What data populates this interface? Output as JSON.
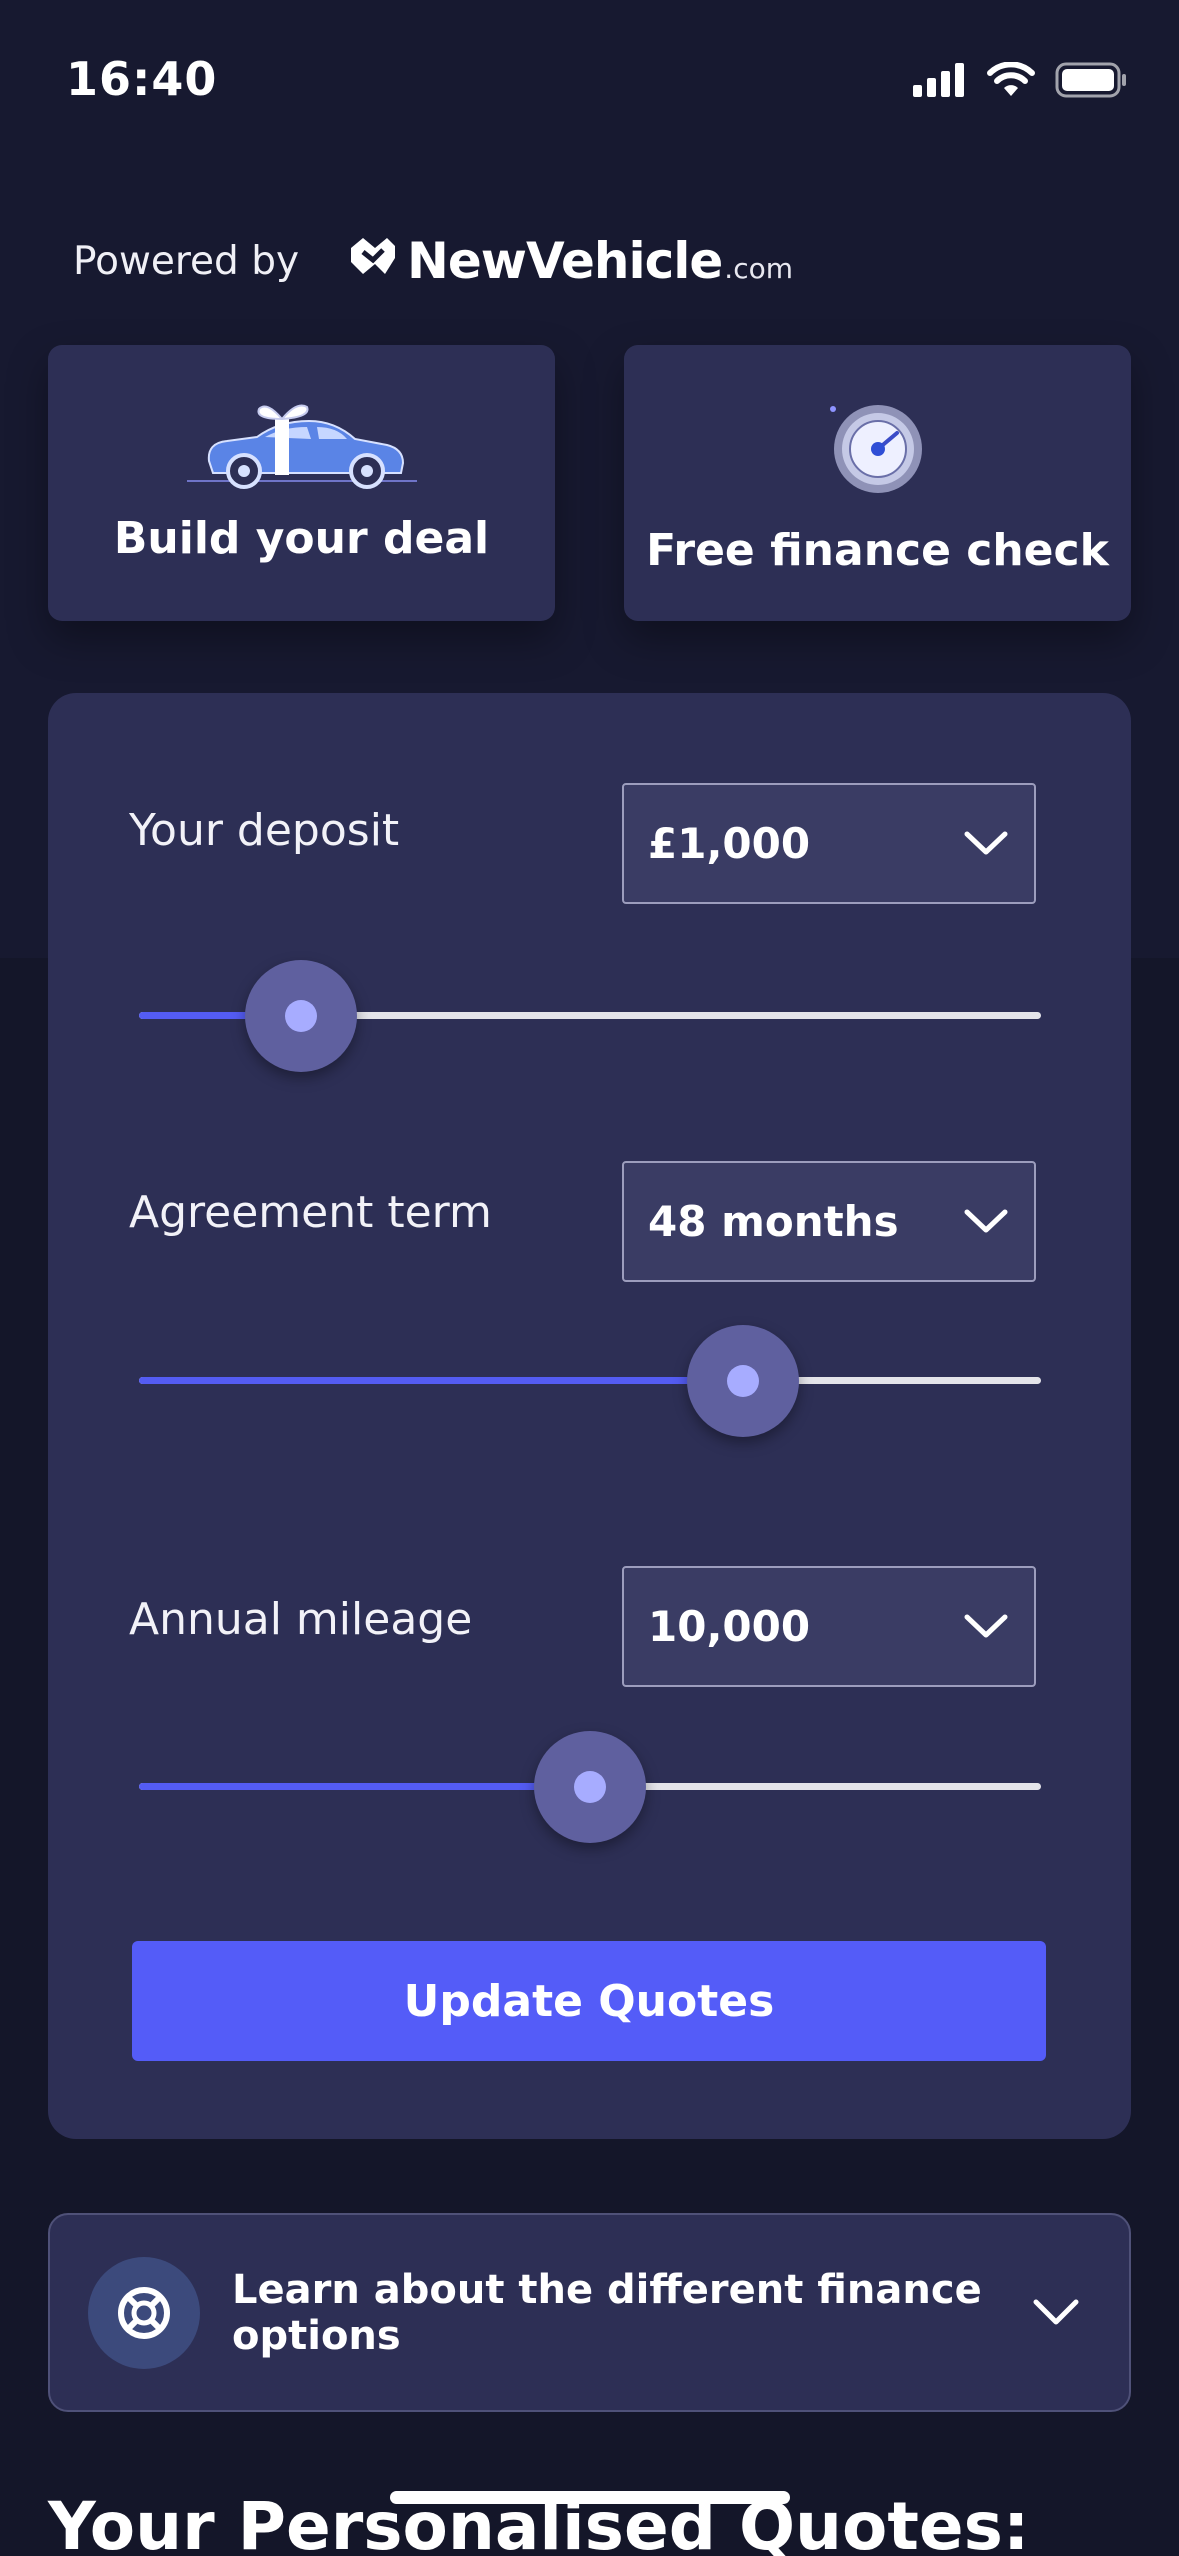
{
  "status_bar": {
    "time": "16:40"
  },
  "header": {
    "powered_by": "Powered by",
    "brand_name": "NewVehicle",
    "brand_suffix": ".com"
  },
  "feature_cards": [
    {
      "label": "Build your deal",
      "icon": "car-gift-icon"
    },
    {
      "label": "Free finance check",
      "icon": "credit-gauge-icon"
    }
  ],
  "calculator": {
    "deposit": {
      "label": "Your deposit",
      "value": "£1,000",
      "slider_fraction": 0.18
    },
    "term": {
      "label": "Agreement term",
      "value": "48 months",
      "slider_fraction": 0.67
    },
    "mileage": {
      "label": "Annual mileage",
      "value": "10,000",
      "slider_fraction": 0.5
    },
    "update_label": "Update Quotes"
  },
  "learn": {
    "label": "Learn about the different finance options",
    "icon": "lifebuoy-icon"
  },
  "quotes_heading": "Your Personalised Quotes:",
  "colors": {
    "accent": "#545cf8",
    "card_bg": "#2d2f55",
    "page_bg": "#141629"
  }
}
